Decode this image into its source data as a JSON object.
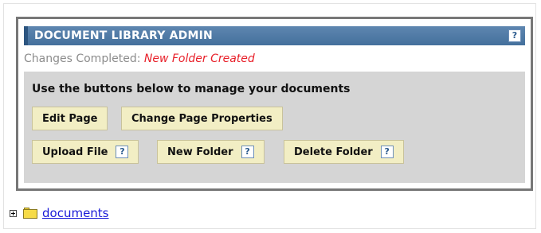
{
  "admin": {
    "title": "DOCUMENT LIBRARY ADMIN",
    "help_glyph": "?",
    "status_label": "Changes Completed: ",
    "status_value": "New Folder Created",
    "instructions": "Use the buttons below to manage your documents",
    "buttons": {
      "edit_page": "Edit Page",
      "change_properties": "Change Page Properties",
      "upload_file": "Upload File",
      "new_folder": "New Folder",
      "delete_folder": "Delete Folder"
    }
  },
  "tree": {
    "expander_icon": "plus-box-icon",
    "folder_icon": "folder-icon",
    "folder_label": "documents"
  },
  "colors": {
    "title_bar": "#4f7aa6",
    "status_value": "#e8202a",
    "button_bg": "#f2eec4",
    "panel_bg": "#d5d5d5",
    "link": "#1a1ad8"
  }
}
